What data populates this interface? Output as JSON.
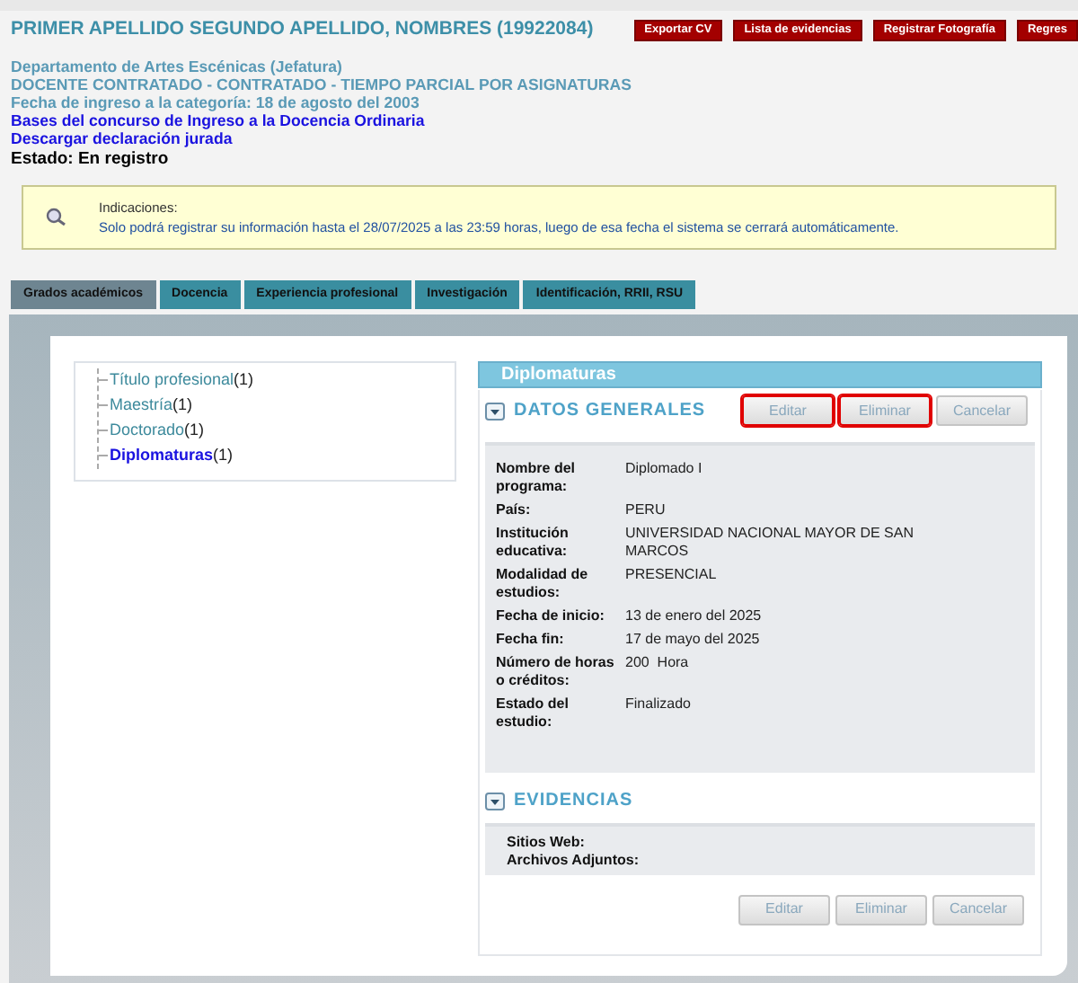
{
  "header": {
    "title": "PRIMER APELLIDO SEGUNDO APELLIDO, NOMBRES (19922084)",
    "buttons": [
      "Exportar CV",
      "Lista de evidencias",
      "Registrar Fotografía",
      "Regres"
    ]
  },
  "info": {
    "lines": [
      {
        "kind": "text",
        "text": "Departamento de Artes Escénicas (Jefatura)"
      },
      {
        "kind": "text",
        "text": "DOCENTE CONTRATADO - CONTRATADO - TIEMPO PARCIAL POR ASIGNATURAS"
      },
      {
        "kind": "text",
        "text": "Fecha de ingreso a la categoría: 18 de agosto del 2003"
      },
      {
        "kind": "link",
        "text": "Bases del concurso de Ingreso a la Docencia Ordinaria"
      },
      {
        "kind": "link",
        "text": "Descargar declaración jurada"
      }
    ],
    "status": "Estado: En registro"
  },
  "notice": {
    "title": "Indicaciones:",
    "text": "Solo podrá registrar su información hasta el 28/07/2025 a las 23:59 horas, luego de esa fecha el sistema se cerrará automáticamente."
  },
  "tabs": [
    {
      "label": "Grados académicos",
      "selected": true
    },
    {
      "label": "Docencia",
      "selected": false
    },
    {
      "label": "Experiencia profesional",
      "selected": false
    },
    {
      "label": "Investigación",
      "selected": false
    },
    {
      "label": "Identificación, RRII, RSU",
      "selected": false
    }
  ],
  "tree": [
    {
      "label": "Título profesional",
      "count": "(1)",
      "selected": false
    },
    {
      "label": "Maestría",
      "count": "(1)",
      "selected": false
    },
    {
      "label": "Doctorado",
      "count": "(1)",
      "selected": false
    },
    {
      "label": "Diplomaturas",
      "count": "(1)",
      "selected": true
    }
  ],
  "detail": {
    "title": "Diplomaturas",
    "general": {
      "title": "DATOS GENERALES",
      "buttons": [
        {
          "label": "Editar",
          "highlighted": true
        },
        {
          "label": "Eliminar",
          "highlighted": true
        },
        {
          "label": "Cancelar",
          "highlighted": false
        }
      ],
      "fields": [
        {
          "label": "Nombre del programa:",
          "value": "Diplomado I"
        },
        {
          "label": "País:",
          "value": "PERU"
        },
        {
          "label": "Institución educativa:",
          "value": "UNIVERSIDAD NACIONAL MAYOR DE SAN MARCOS"
        },
        {
          "label": "Modalidad de estudios:",
          "value": "PRESENCIAL"
        },
        {
          "label": "Fecha de inicio:",
          "value": "13 de enero del 2025"
        },
        {
          "label": "Fecha fin:",
          "value": "17 de mayo del 2025"
        },
        {
          "label": "Número de horas o créditos:",
          "value": "200  Hora"
        },
        {
          "label": "Estado del estudio:",
          "value": "Finalizado"
        }
      ]
    },
    "evidence": {
      "title": "EVIDENCIAS",
      "fields": [
        "Sitios Web:",
        "Archivos Adjuntos:"
      ]
    },
    "buttons": [
      {
        "label": "Editar",
        "highlighted": false
      },
      {
        "label": "Eliminar",
        "highlighted": false
      },
      {
        "label": "Cancelar",
        "highlighted": false
      }
    ]
  }
}
